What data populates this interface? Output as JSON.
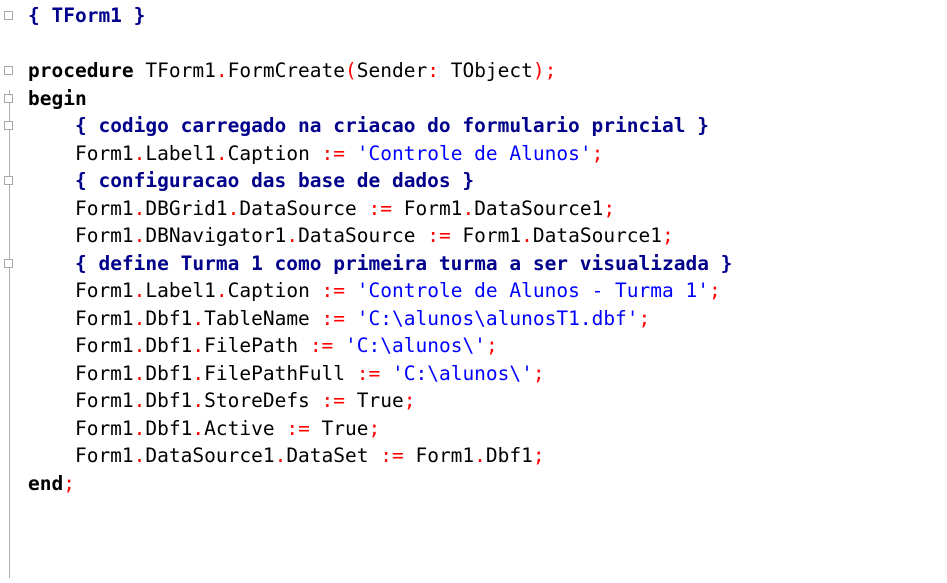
{
  "editor": {
    "lines": [
      [
        {
          "t": "{ TForm1 }",
          "c": "cm"
        }
      ],
      [],
      [
        {
          "t": "procedure",
          "c": "kw"
        },
        {
          "t": " TForm1",
          "c": "id"
        },
        {
          "t": ".",
          "c": "op"
        },
        {
          "t": "FormCreate",
          "c": "id"
        },
        {
          "t": "(",
          "c": "op"
        },
        {
          "t": "Sender",
          "c": "id"
        },
        {
          "t": ":",
          "c": "op"
        },
        {
          "t": " TObject",
          "c": "id"
        },
        {
          "t": ");",
          "c": "op"
        }
      ],
      [
        {
          "t": "begin",
          "c": "kw"
        }
      ],
      [
        {
          "t": "  "
        },
        {
          "t": "{ codigo carregado na criacao do formulario princial }",
          "c": "cm"
        }
      ],
      [
        {
          "t": "  Form1",
          "c": "id"
        },
        {
          "t": ".",
          "c": "op"
        },
        {
          "t": "Label1",
          "c": "id"
        },
        {
          "t": ".",
          "c": "op"
        },
        {
          "t": "Caption ",
          "c": "id"
        },
        {
          "t": ":=",
          "c": "op"
        },
        {
          "t": " "
        },
        {
          "t": "'Controle de Alunos'",
          "c": "str"
        },
        {
          "t": ";",
          "c": "op"
        }
      ],
      [
        {
          "t": "  "
        },
        {
          "t": "{ configuracao das base de dados }",
          "c": "cm"
        }
      ],
      [
        {
          "t": "  Form1",
          "c": "id"
        },
        {
          "t": ".",
          "c": "op"
        },
        {
          "t": "DBGrid1",
          "c": "id"
        },
        {
          "t": ".",
          "c": "op"
        },
        {
          "t": "DataSource ",
          "c": "id"
        },
        {
          "t": ":=",
          "c": "op"
        },
        {
          "t": " Form1",
          "c": "id"
        },
        {
          "t": ".",
          "c": "op"
        },
        {
          "t": "DataSource1",
          "c": "id"
        },
        {
          "t": ";",
          "c": "op"
        }
      ],
      [
        {
          "t": "  Form1",
          "c": "id"
        },
        {
          "t": ".",
          "c": "op"
        },
        {
          "t": "DBNavigator1",
          "c": "id"
        },
        {
          "t": ".",
          "c": "op"
        },
        {
          "t": "DataSource ",
          "c": "id"
        },
        {
          "t": ":=",
          "c": "op"
        },
        {
          "t": " Form1",
          "c": "id"
        },
        {
          "t": ".",
          "c": "op"
        },
        {
          "t": "DataSource1",
          "c": "id"
        },
        {
          "t": ";",
          "c": "op"
        }
      ],
      [
        {
          "t": "  "
        },
        {
          "t": "{ define Turma 1 como primeira turma a ser visualizada }",
          "c": "cm"
        }
      ],
      [
        {
          "t": "  Form1",
          "c": "id"
        },
        {
          "t": ".",
          "c": "op"
        },
        {
          "t": "Label1",
          "c": "id"
        },
        {
          "t": ".",
          "c": "op"
        },
        {
          "t": "Caption ",
          "c": "id"
        },
        {
          "t": ":=",
          "c": "op"
        },
        {
          "t": " "
        },
        {
          "t": "'Controle de Alunos - Turma 1'",
          "c": "str"
        },
        {
          "t": ";",
          "c": "op"
        }
      ],
      [
        {
          "t": "  Form1",
          "c": "id"
        },
        {
          "t": ".",
          "c": "op"
        },
        {
          "t": "Dbf1",
          "c": "id"
        },
        {
          "t": ".",
          "c": "op"
        },
        {
          "t": "TableName ",
          "c": "id"
        },
        {
          "t": ":=",
          "c": "op"
        },
        {
          "t": " "
        },
        {
          "t": "'C:\\alunos\\alunosT1.dbf'",
          "c": "str"
        },
        {
          "t": ";",
          "c": "op"
        }
      ],
      [
        {
          "t": "  Form1",
          "c": "id"
        },
        {
          "t": ".",
          "c": "op"
        },
        {
          "t": "Dbf1",
          "c": "id"
        },
        {
          "t": ".",
          "c": "op"
        },
        {
          "t": "FilePath ",
          "c": "id"
        },
        {
          "t": ":=",
          "c": "op"
        },
        {
          "t": " "
        },
        {
          "t": "'C:\\alunos\\'",
          "c": "str"
        },
        {
          "t": ";",
          "c": "op"
        }
      ],
      [
        {
          "t": "  Form1",
          "c": "id"
        },
        {
          "t": ".",
          "c": "op"
        },
        {
          "t": "Dbf1",
          "c": "id"
        },
        {
          "t": ".",
          "c": "op"
        },
        {
          "t": "FilePathFull ",
          "c": "id"
        },
        {
          "t": ":=",
          "c": "op"
        },
        {
          "t": " "
        },
        {
          "t": "'C:\\alunos\\'",
          "c": "str"
        },
        {
          "t": ";",
          "c": "op"
        }
      ],
      [
        {
          "t": "  Form1",
          "c": "id"
        },
        {
          "t": ".",
          "c": "op"
        },
        {
          "t": "Dbf1",
          "c": "id"
        },
        {
          "t": ".",
          "c": "op"
        },
        {
          "t": "StoreDefs ",
          "c": "id"
        },
        {
          "t": ":=",
          "c": "op"
        },
        {
          "t": " True",
          "c": "id"
        },
        {
          "t": ";",
          "c": "op"
        }
      ],
      [
        {
          "t": "  Form1",
          "c": "id"
        },
        {
          "t": ".",
          "c": "op"
        },
        {
          "t": "Dbf1",
          "c": "id"
        },
        {
          "t": ".",
          "c": "op"
        },
        {
          "t": "Active ",
          "c": "id"
        },
        {
          "t": ":=",
          "c": "op"
        },
        {
          "t": " True",
          "c": "id"
        },
        {
          "t": ";",
          "c": "op"
        }
      ],
      [
        {
          "t": "  Form1",
          "c": "id"
        },
        {
          "t": ".",
          "c": "op"
        },
        {
          "t": "DataSource1",
          "c": "id"
        },
        {
          "t": ".",
          "c": "op"
        },
        {
          "t": "DataSet ",
          "c": "id"
        },
        {
          "t": ":=",
          "c": "op"
        },
        {
          "t": " Form1",
          "c": "id"
        },
        {
          "t": ".",
          "c": "op"
        },
        {
          "t": "Dbf1",
          "c": "id"
        },
        {
          "t": ";",
          "c": "op"
        }
      ],
      [
        {
          "t": "end",
          "c": "kw"
        },
        {
          "t": ";",
          "c": "op"
        }
      ]
    ],
    "fold_markers": [
      0,
      2,
      3,
      4,
      6,
      9
    ]
  }
}
